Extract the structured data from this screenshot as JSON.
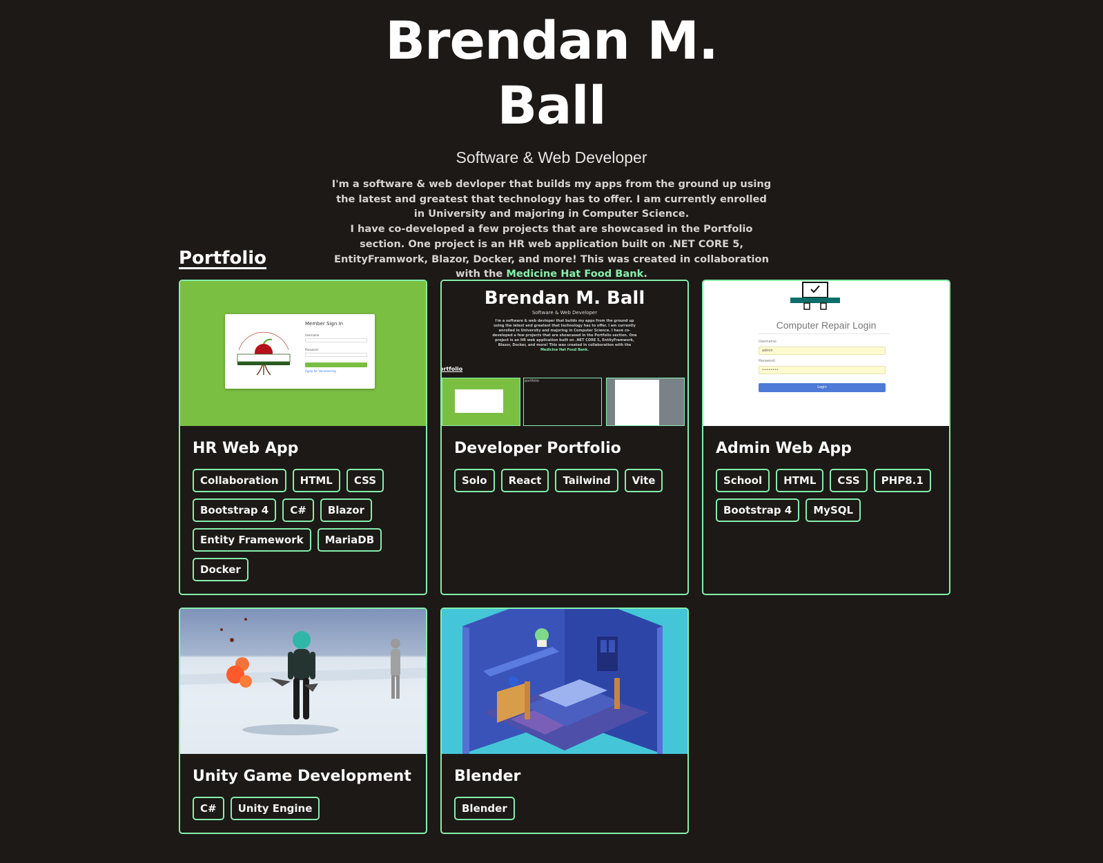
{
  "header": {
    "name": "Brendan M. Ball",
    "subtitle": "Software & Web Developer",
    "bio_line1": "I'm a software & web devloper that builds my apps from the ground up using the latest and greatest that technology has to offer. I am currently enrolled in University and majoring in Computer Science.",
    "bio_line2": "I have co-developed a few projects that are showcased in the Portfolio section. One project is an HR web application built on .NET CORE 5, EntityFramwork, Blazor, Docker, and more! This was created in collaboration with the",
    "bio_link": "Medicine Hat Food Bank",
    "bio_end": "."
  },
  "portfolio": {
    "title": "Portfolio",
    "cards": [
      {
        "title": "HR Web App",
        "tags": [
          "Collaboration",
          "HTML",
          "CSS",
          "Bootstrap 4",
          "C#",
          "Blazor",
          "Entity Framework",
          "MariaDB",
          "Docker"
        ],
        "thumb": {
          "logo_top": "Medicine Hat and District",
          "logo_main": "FOOD BANK",
          "logo_sub": "Caring and Sharing",
          "form_title": "Member Sign In",
          "username": "Username",
          "password": "Password",
          "button": "Log in",
          "link": "Apply for Volunteering"
        }
      },
      {
        "title": "Developer Portfolio",
        "tags": [
          "Solo",
          "React",
          "Tailwind",
          "Vite"
        ],
        "thumb": {
          "name": "Brendan M. Ball",
          "subtitle": "Software & Web Developer",
          "bio": "I'm a software & web devloper that builds my apps from the ground up using the latest and greatest that technology has to offer. I am currently enrolled in University and majoring in Computer Science. I have co-developed a few projects that are showcased in the Portfolio section. One project is an HR web application built on .NET CORE 5, EntityFramwork, Blazor, Docker, and more! This was created in collaboration with the",
          "bio_link": "Medicine Hat Food Bank.",
          "portfolio_label": "ortfolio",
          "card2_label": "portfolio"
        }
      },
      {
        "title": "Admin Web App",
        "tags": [
          "School",
          "HTML",
          "CSS",
          "PHP8.1",
          "Bootstrap 4",
          "MySQL"
        ],
        "thumb": {
          "logo_text": "GROUP 2 COMPUTER REPAIR",
          "heading": "Computer Repair Login",
          "username_label": "Username:",
          "username_value": "admin",
          "password_label": "Password:",
          "password_value": "••••••••",
          "button": "Login"
        }
      },
      {
        "title": "Unity Game Development",
        "tags": [
          "C#",
          "Unity Engine"
        ]
      },
      {
        "title": "Blender",
        "tags": [
          "Blender"
        ]
      }
    ]
  },
  "colors": {
    "background": "#1c1917",
    "accent": "#86efac",
    "hr_green": "#7bbf42",
    "admin_button": "#4e7ad8"
  }
}
